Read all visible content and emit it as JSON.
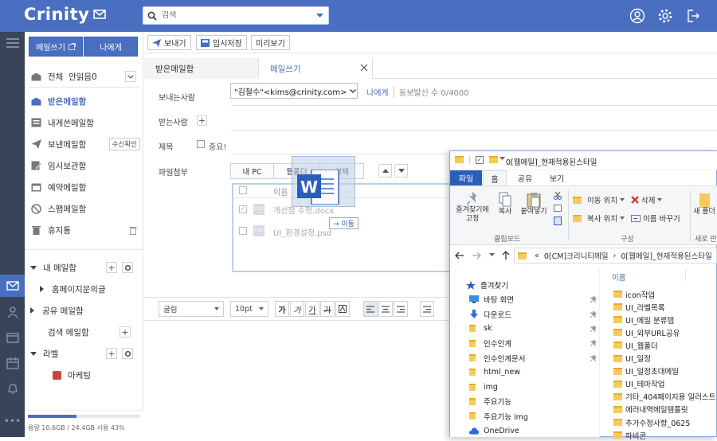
{
  "app": {
    "logo": "Crinity"
  },
  "search": {
    "placeholder": "검색"
  },
  "sidebar": {
    "write_button": "메일쓰기",
    "to_me_button": "나에게",
    "all_label": "전체",
    "unread_label": "안읽음0",
    "items": [
      {
        "label": "받은메일함",
        "icon": "inbox-icon"
      },
      {
        "label": "내게쓴메일함",
        "icon": "self-mail-icon"
      },
      {
        "label": "보낸메일함",
        "icon": "send-icon",
        "tag": "수신확인"
      },
      {
        "label": "임시보관함",
        "icon": "draft-icon"
      },
      {
        "label": "예약메일함",
        "icon": "scheduled-icon"
      },
      {
        "label": "스팸메일함",
        "icon": "spam-icon"
      },
      {
        "label": "휴지통",
        "icon": "trash-icon"
      }
    ],
    "my_mailbox": "내 메일함",
    "homepage_inquiry": "홈페이지문의글",
    "shared_mailbox": "공유 메일함",
    "search_mailbox": "검색 메일함",
    "labels": "라벨",
    "label_items": [
      {
        "label": "마케팅",
        "color": "#c9463d"
      }
    ],
    "storage_text": "용량 10.6GB / 24.4GB 사용 43%",
    "storage_used": 0.43
  },
  "toolbar": {
    "send": "보내기",
    "save_draft": "임시저장",
    "preview": "미리보기"
  },
  "tabs": {
    "inbox": "받은메일함",
    "compose": "메일쓰기"
  },
  "compose": {
    "sender_label": "보내는사람",
    "sender_value": "\"김철수\"<kims@crinity.com>",
    "to_me_link": "나에게",
    "simultaneous": "동보발신 수 0/4000",
    "recipient_label": "받는사람",
    "subject_label": "제목",
    "important_label": "중요!",
    "attachment_label": "파일첨부",
    "my_pc_button": "내 PC",
    "web_folder_button": "웹폴더",
    "delete_button": "삭제",
    "file_header": "이름",
    "files": [
      {
        "name": "개선점 수정.docx",
        "type": "doc"
      },
      {
        "name": "UI_환경설정.psd",
        "type": "psd"
      }
    ],
    "drag_move_label": "→ 이동"
  },
  "format": {
    "font": "굴림",
    "size": "10pt",
    "buttons": [
      "가",
      "가",
      "가",
      "가"
    ]
  },
  "explorer": {
    "title": "0[웹메일]_현재적용된스타일",
    "tabs": [
      "파일",
      "홈",
      "공유",
      "보기"
    ],
    "pin_label": "즐겨찾기에 고정",
    "copy_label": "복사",
    "paste_label": "붙여넣기",
    "clipboard_group": "클립보드",
    "move_to": "이동 위치",
    "copy_to": "복사 위치",
    "delete": "삭제",
    "rename": "이름 바꾸기",
    "organize_group": "구성",
    "new_folder": "새 폴더",
    "new_group": "새로 만",
    "path": [
      "0[CM]크리니티메일",
      "0[웹메일]_현재적용된스타일"
    ],
    "path_prefix": "«",
    "name_header": "이름",
    "nav": [
      {
        "label": "즐겨찾기",
        "icon": "star-icon",
        "pinned": false
      },
      {
        "label": "바탕 화면",
        "icon": "desktop-icon",
        "pinned": true
      },
      {
        "label": "다운로드",
        "icon": "download-icon",
        "pinned": true
      },
      {
        "label": "sk",
        "icon": "folder-icon",
        "pinned": true
      },
      {
        "label": "인수인계",
        "icon": "folder-icon",
        "pinned": true
      },
      {
        "label": "인수인계문서",
        "icon": "folder-icon",
        "pinned": true
      },
      {
        "label": "html_new",
        "icon": "folder-icon",
        "pinned": false
      },
      {
        "label": "img",
        "icon": "folder-icon",
        "pinned": false
      },
      {
        "label": "주요기능",
        "icon": "folder-icon",
        "pinned": false
      },
      {
        "label": "주요기능 img",
        "icon": "folder-icon",
        "pinned": false
      },
      {
        "label": "OneDrive",
        "icon": "cloud-icon",
        "pinned": false
      }
    ],
    "files": [
      "icon작업",
      "UI_라벨목록",
      "UI_메일 분류탭",
      "UI_외부URL공유",
      "UI_웹폴더",
      "UI_일정",
      "UI_일정초대메일",
      "UI_테마작업",
      "기타_404페이지용 일러스트",
      "에러내역메일템플릿",
      "추가수정사항_0625",
      "파비콘"
    ]
  }
}
